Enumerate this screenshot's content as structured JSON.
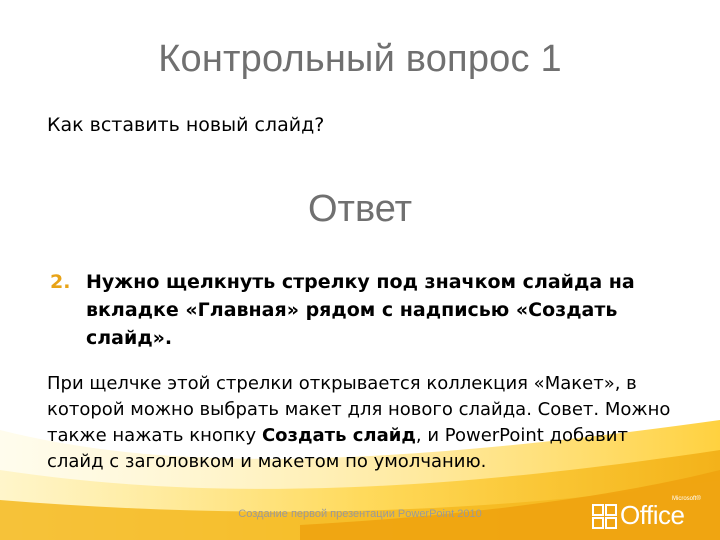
{
  "slide": {
    "title": "Контрольный вопрос 1",
    "question": "Как вставить новый слайд?",
    "answer_heading": "Ответ",
    "answer_item": {
      "number": "2.",
      "text": "Нужно щелкнуть стрелку под значком слайда на вкладке «Главная» рядом с надписью «Создать слайд»."
    },
    "body": {
      "part1": "При щелчке этой стрелки открывается коллекция «Макет», в которой можно выбрать макет для нового слайда. Совет. Можно также нажать кнопку ",
      "bold": "Создать слайд",
      "part2": ", и PowerPoint добавит слайд с заголовком и макетом по умолчанию."
    },
    "footer": "Создание первой презентации PowerPoint 2010",
    "logo": {
      "word": "Office",
      "small": "Microsoft®"
    }
  },
  "colors": {
    "title": "#707070",
    "number_accent": "#e8a317",
    "swoosh": "#f7c52c"
  }
}
